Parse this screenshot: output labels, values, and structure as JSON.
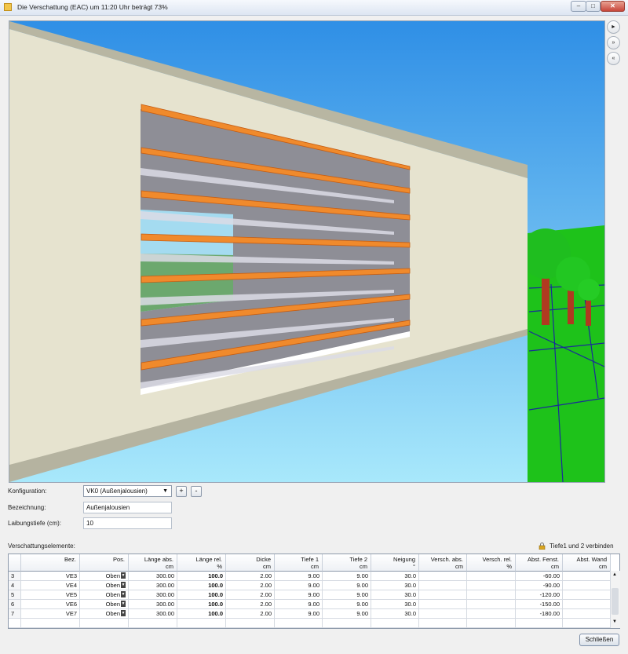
{
  "window": {
    "title": "Die Verschattung (EAC) um 11:20 Uhr beträgt  73%",
    "minimize_label": "–",
    "maximize_label": "□",
    "close_label": "✕"
  },
  "viewport_controls": {
    "play_icon": "play-icon",
    "forward_icon": "fast-forward-icon",
    "rewind_icon": "rewind-icon",
    "play_label": "►",
    "forward_label": "»",
    "rewind_label": "«"
  },
  "form": {
    "konfiguration_label": "Konfiguration:",
    "konfiguration_value": "VK0 (Außenjalousien)",
    "add_label": "+",
    "remove_label": "-",
    "bezeichnung_label": "Bezeichnung:",
    "bezeichnung_value": "Außenjalousien",
    "laibung_label": "Laibungstiefe (cm):",
    "laibung_value": "10"
  },
  "elements_section": {
    "label": "Verschattungselemente:",
    "connect_label": "Tiefe1 und 2 verbinden"
  },
  "table": {
    "columns": [
      {
        "name": "Bez.",
        "unit": ""
      },
      {
        "name": "Pos.",
        "unit": ""
      },
      {
        "name": "Länge abs.",
        "unit": "cm"
      },
      {
        "name": "Länge rel.",
        "unit": "%"
      },
      {
        "name": "Dicke",
        "unit": "cm"
      },
      {
        "name": "Tiefe 1",
        "unit": "cm"
      },
      {
        "name": "Tiefe 2",
        "unit": "cm"
      },
      {
        "name": "Neigung",
        "unit": "°"
      },
      {
        "name": "Versch. abs.",
        "unit": "cm"
      },
      {
        "name": "Versch. rel.",
        "unit": "%"
      },
      {
        "name": "Abst. Fenst.",
        "unit": "cm"
      },
      {
        "name": "Abst. Wand",
        "unit": "cm"
      }
    ],
    "rows": [
      {
        "num": "3",
        "bez": "VE3",
        "pos": "Oben",
        "laenge_abs": "300.00",
        "laenge_rel": "100.0",
        "dicke": "2.00",
        "tiefe1": "9.00",
        "tiefe2": "9.00",
        "neigung": "30.0",
        "versch_abs": "",
        "versch_rel": "",
        "abst_fenst": "-60.00",
        "abst_wand": ""
      },
      {
        "num": "4",
        "bez": "VE4",
        "pos": "Oben",
        "laenge_abs": "300.00",
        "laenge_rel": "100.0",
        "dicke": "2.00",
        "tiefe1": "9.00",
        "tiefe2": "9.00",
        "neigung": "30.0",
        "versch_abs": "",
        "versch_rel": "",
        "abst_fenst": "-90.00",
        "abst_wand": ""
      },
      {
        "num": "5",
        "bez": "VE5",
        "pos": "Oben",
        "laenge_abs": "300.00",
        "laenge_rel": "100.0",
        "dicke": "2.00",
        "tiefe1": "9.00",
        "tiefe2": "9.00",
        "neigung": "30.0",
        "versch_abs": "",
        "versch_rel": "",
        "abst_fenst": "-120.00",
        "abst_wand": ""
      },
      {
        "num": "6",
        "bez": "VE6",
        "pos": "Oben",
        "laenge_abs": "300.00",
        "laenge_rel": "100.0",
        "dicke": "2.00",
        "tiefe1": "9.00",
        "tiefe2": "9.00",
        "neigung": "30.0",
        "versch_abs": "",
        "versch_rel": "",
        "abst_fenst": "-150.00",
        "abst_wand": ""
      },
      {
        "num": "7",
        "bez": "VE7",
        "pos": "Oben",
        "laenge_abs": "300.00",
        "laenge_rel": "100.0",
        "dicke": "2.00",
        "tiefe1": "9.00",
        "tiefe2": "9.00",
        "neigung": "30.0",
        "versch_abs": "",
        "versch_rel": "",
        "abst_fenst": "-180.00",
        "abst_wand": ""
      }
    ]
  },
  "footer": {
    "close_label": "Schließen"
  },
  "colors": {
    "sky": "#3fa9ee",
    "wall": "#e6e3cf",
    "slat": "#f08a2c",
    "grass": "#1ec21a",
    "trunk": "#b03a20"
  }
}
